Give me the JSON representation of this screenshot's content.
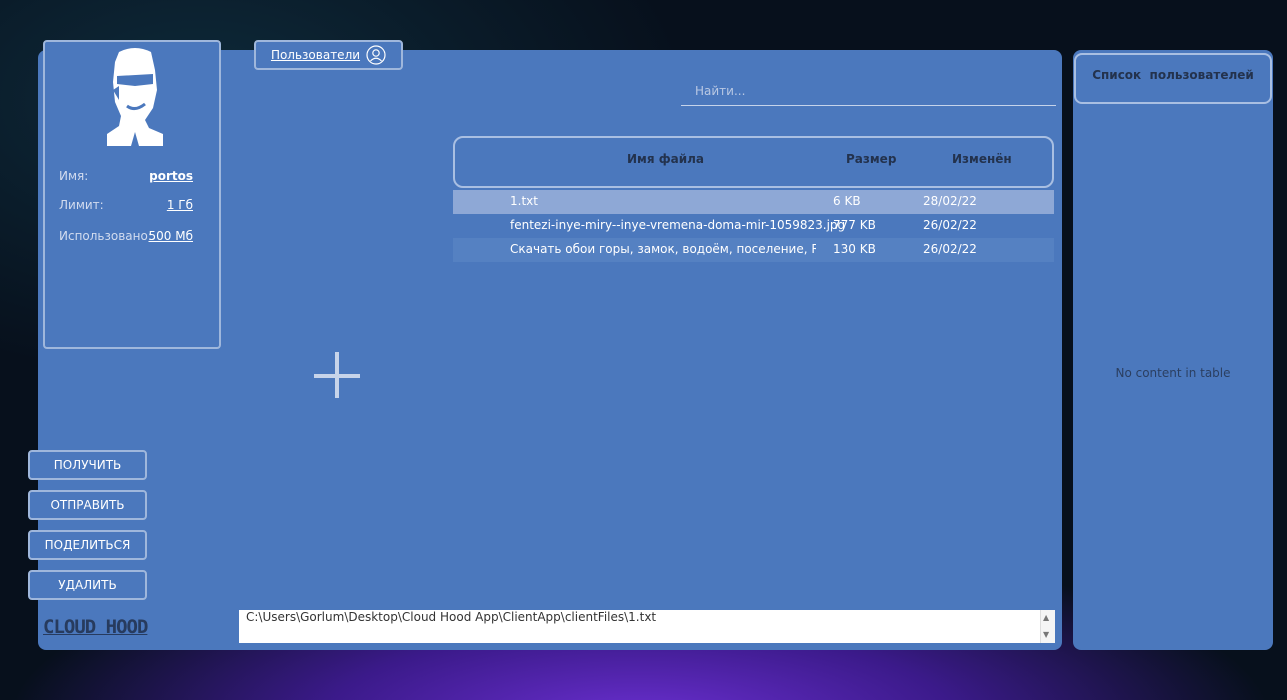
{
  "profile": {
    "name_label": "Имя:",
    "name_value": "portos",
    "limit_label": "Лимит:",
    "limit_value": "1 Гб",
    "used_label": "Использовано:",
    "used_value": "500 Мб"
  },
  "users_tab": {
    "label": "Пользователи",
    "icon": "user-circle-icon"
  },
  "search": {
    "placeholder": "Найти..."
  },
  "table": {
    "headers": [
      "Имя файла",
      "Размер",
      "Изменён"
    ],
    "rows": [
      {
        "name": "1.txt",
        "size": "6 KB",
        "modified": "28/02/22",
        "selected": true
      },
      {
        "name": "fentezi-inye-miry--inye-vremena-doma-mir-1059823.jpg",
        "size": "777 KB",
        "modified": "26/02/22",
        "selected": false
      },
      {
        "name": "Скачать обои горы, замок, водоём, поселение, Rapha...",
        "size": "130 KB",
        "modified": "26/02/22",
        "selected": false
      }
    ]
  },
  "actions": {
    "get": "ПОЛУЧИТЬ",
    "send": "ОТПРАВИТЬ",
    "share": "ПОДЕЛИТЬСЯ",
    "delete": "УДАЛИТЬ"
  },
  "logo": "CLOUD HOOD",
  "path": "C:\\Users\\Gorlum\\Desktop\\Cloud Hood App\\ClientApp\\clientFiles\\1.txt",
  "users_panel": {
    "title": "Список  пользователей",
    "empty": "No content in table"
  },
  "colors": {
    "panel": "#4b78bd",
    "selected_row": "#8ea8d6",
    "alt_row": "#5581c2",
    "border": "#9fb7dc"
  }
}
